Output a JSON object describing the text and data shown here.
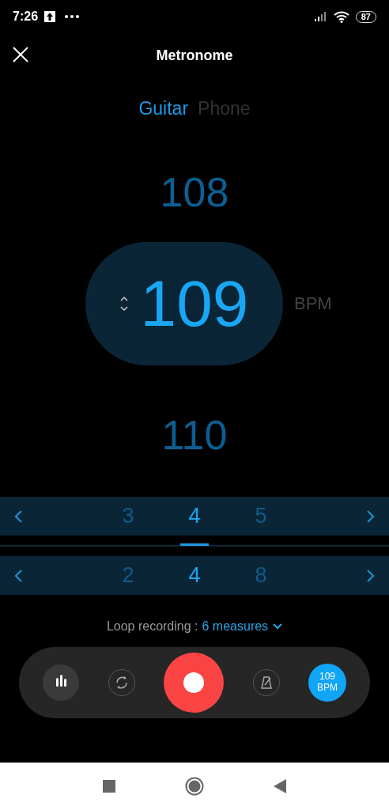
{
  "status_bar": {
    "time": "7:26",
    "battery": "87"
  },
  "header": {
    "title": "Metronome"
  },
  "tabs": [
    {
      "label": "Guitar",
      "selected": true
    },
    {
      "label": "Phone",
      "selected": false
    }
  ],
  "tempo": {
    "previous": "108",
    "current": "109",
    "next": "110",
    "unit": "BPM"
  },
  "beat_pickers": [
    {
      "items": [
        {
          "label": "3",
          "selected": false
        },
        {
          "label": "4",
          "selected": true
        },
        {
          "label": "5",
          "selected": false
        }
      ]
    },
    {
      "items": [
        {
          "label": "2",
          "selected": false
        },
        {
          "label": "4",
          "selected": true
        },
        {
          "label": "8",
          "selected": false
        }
      ]
    }
  ],
  "loop": {
    "label": "Loop recording :",
    "value": "6 measures"
  },
  "controls": [
    {
      "kind": "stats",
      "active": true
    },
    {
      "kind": "loop",
      "active": false
    },
    {
      "kind": "record"
    },
    {
      "kind": "metronome",
      "active": false
    },
    {
      "kind": "bpm",
      "lines": [
        "109",
        "BPM"
      ]
    }
  ]
}
